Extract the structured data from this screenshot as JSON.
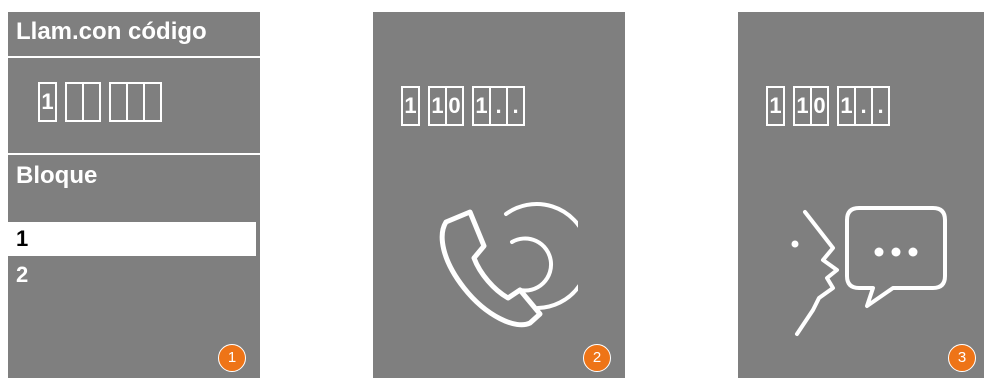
{
  "screen1": {
    "title": "Llam.con código",
    "code_boxes": [
      "1",
      "",
      "",
      "",
      "",
      ""
    ],
    "block_label": "Bloque",
    "list": [
      "1",
      "2"
    ],
    "selected_index": 0,
    "badge": "1"
  },
  "screen2": {
    "code_boxes": [
      "1",
      "1",
      "0",
      "1",
      ".",
      "."
    ],
    "icon": "phone-calling-icon",
    "badge": "2"
  },
  "screen3": {
    "code_boxes": [
      "1",
      "1",
      "0",
      "1",
      ".",
      "."
    ],
    "icon": "speaking-chat-icon",
    "badge": "3"
  },
  "colors": {
    "screen_bg": "#7f7f7f",
    "badge": "#ee7417",
    "foreground": "#ffffff"
  }
}
